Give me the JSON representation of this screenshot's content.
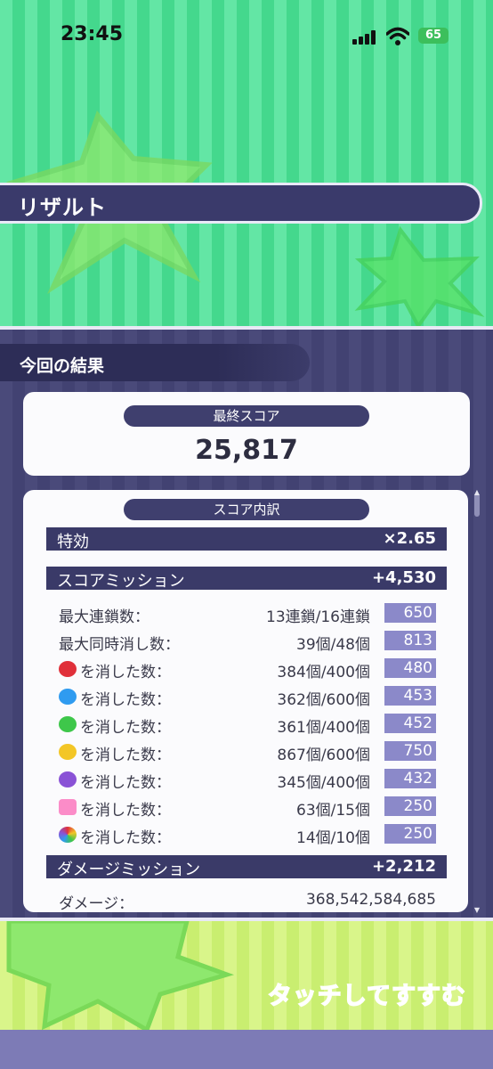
{
  "status_bar": {
    "time": "23:45",
    "battery": "65"
  },
  "header": {
    "title": "リザルト"
  },
  "section": {
    "title": "今回の結果"
  },
  "final_score": {
    "label": "最終スコア",
    "value": "25,817"
  },
  "breakdown": {
    "label": "スコア内訳",
    "special": {
      "label": "特効",
      "value": "×2.65"
    },
    "score_mission": {
      "label": "スコアミッション",
      "value": "+4,530",
      "rows": [
        {
          "label": "最大連鎖数：",
          "value": "13連鎖/16連鎖",
          "points": "650"
        },
        {
          "label": "最大同時消し数：",
          "value": "39個/48個",
          "points": "813"
        },
        {
          "icon": "red-puyo-icon",
          "label": "を消した数：",
          "value": "384個/400個",
          "points": "480"
        },
        {
          "icon": "blue-puyo-icon",
          "label": "を消した数：",
          "value": "362個/600個",
          "points": "453"
        },
        {
          "icon": "green-puyo-icon",
          "label": "を消した数：",
          "value": "361個/400個",
          "points": "452"
        },
        {
          "icon": "yellow-puyo-icon",
          "label": "を消した数：",
          "value": "867個/600個",
          "points": "750"
        },
        {
          "icon": "purple-puyo-icon",
          "label": "を消した数：",
          "value": "345個/400個",
          "points": "432"
        },
        {
          "icon": "heart-icon",
          "label": "を消した数：",
          "value": "63個/15個",
          "points": "250"
        },
        {
          "icon": "prism-icon",
          "label": "を消した数：",
          "value": "14個/10個",
          "points": "250"
        }
      ]
    },
    "damage_mission": {
      "label": "ダメージミッション",
      "value": "+2,212",
      "damage_label": "ダメージ：",
      "damage_value": "368,542,584,685"
    }
  },
  "footer": {
    "proceed": "タッチしてすすむ"
  },
  "colors": {
    "header_green": "#63e6a5",
    "panel_navy": "#3a3a68",
    "points_purple": "#8b89c9",
    "bottom_lime": "#d9f58a"
  }
}
